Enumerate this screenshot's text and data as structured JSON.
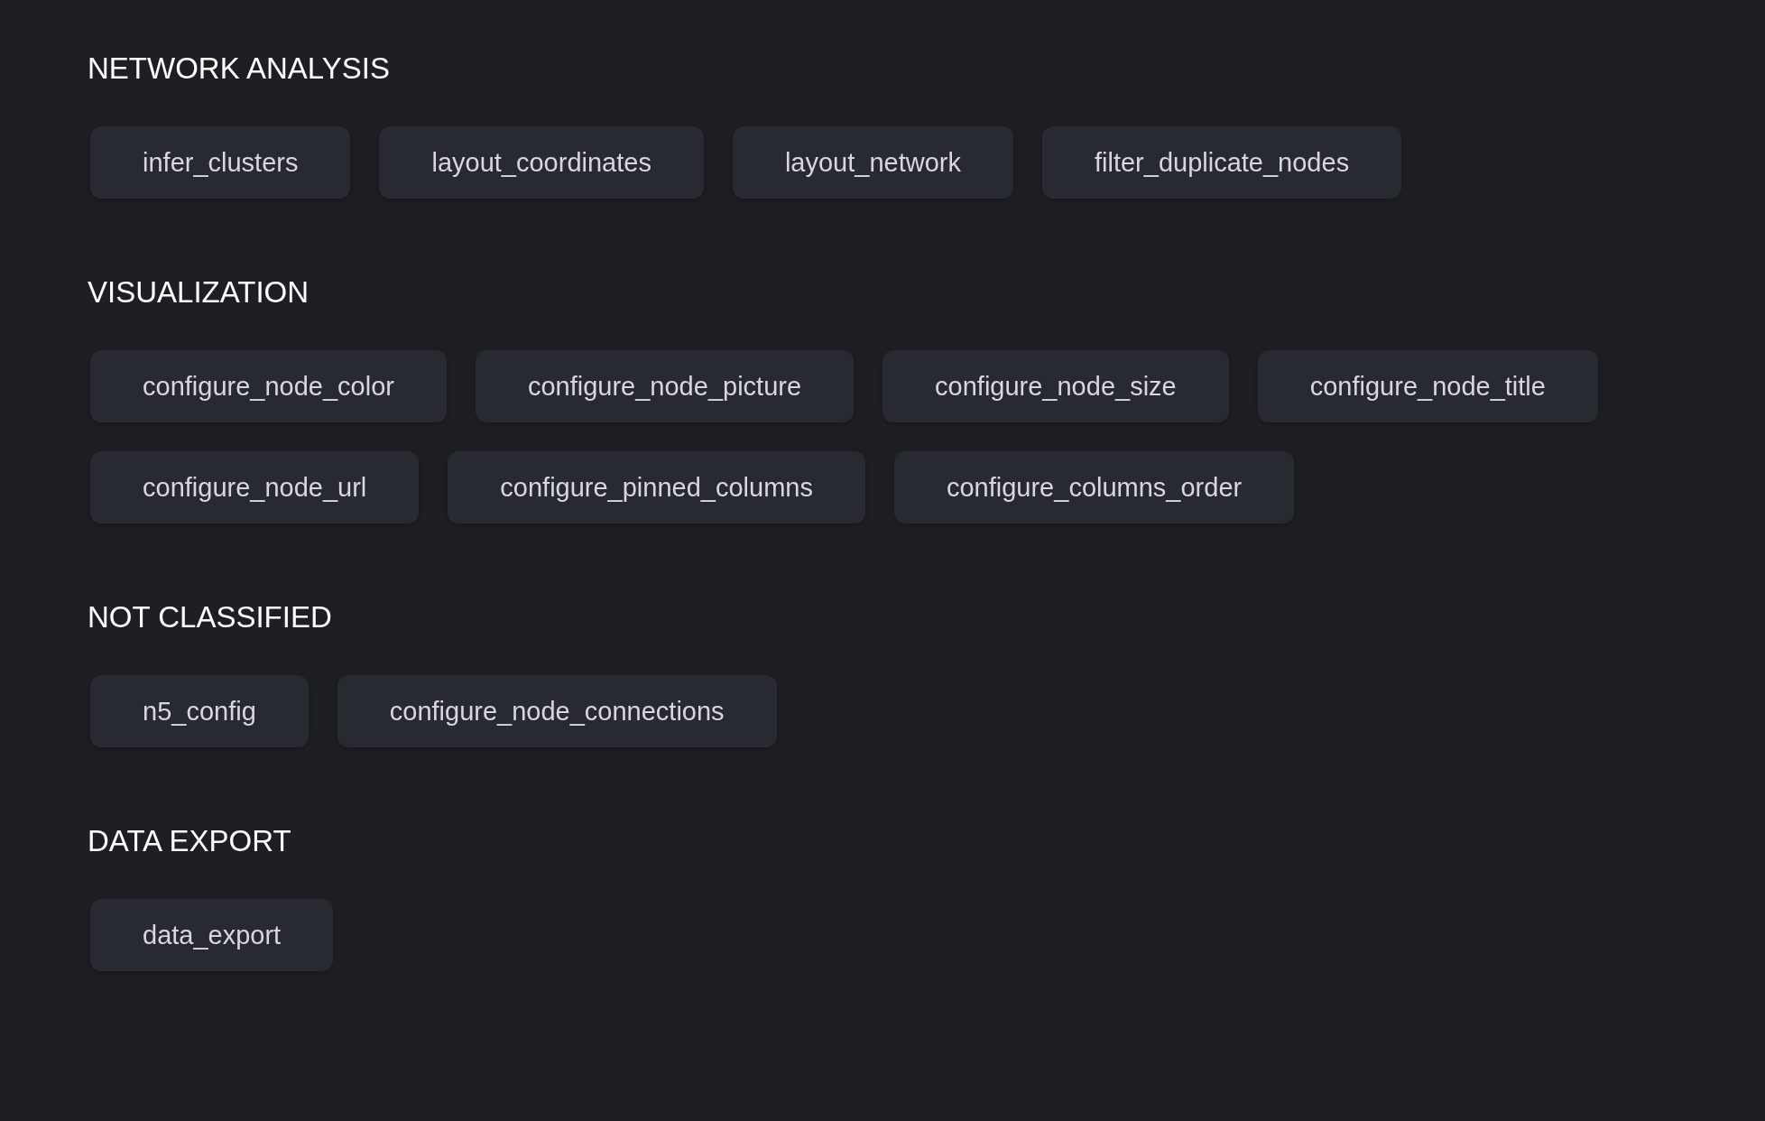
{
  "sections": [
    {
      "title": "NETWORK ANALYSIS",
      "chips": [
        "infer_clusters",
        "layout_coordinates",
        "layout_network",
        "filter_duplicate_nodes"
      ]
    },
    {
      "title": "VISUALIZATION",
      "chips": [
        "configure_node_color",
        "configure_node_picture",
        "configure_node_size",
        "configure_node_title",
        "configure_node_url",
        "configure_pinned_columns",
        "configure_columns_order"
      ]
    },
    {
      "title": "NOT CLASSIFIED",
      "chips": [
        "n5_config",
        "configure_node_connections"
      ]
    },
    {
      "title": "DATA EXPORT",
      "chips": [
        "data_export"
      ]
    }
  ]
}
